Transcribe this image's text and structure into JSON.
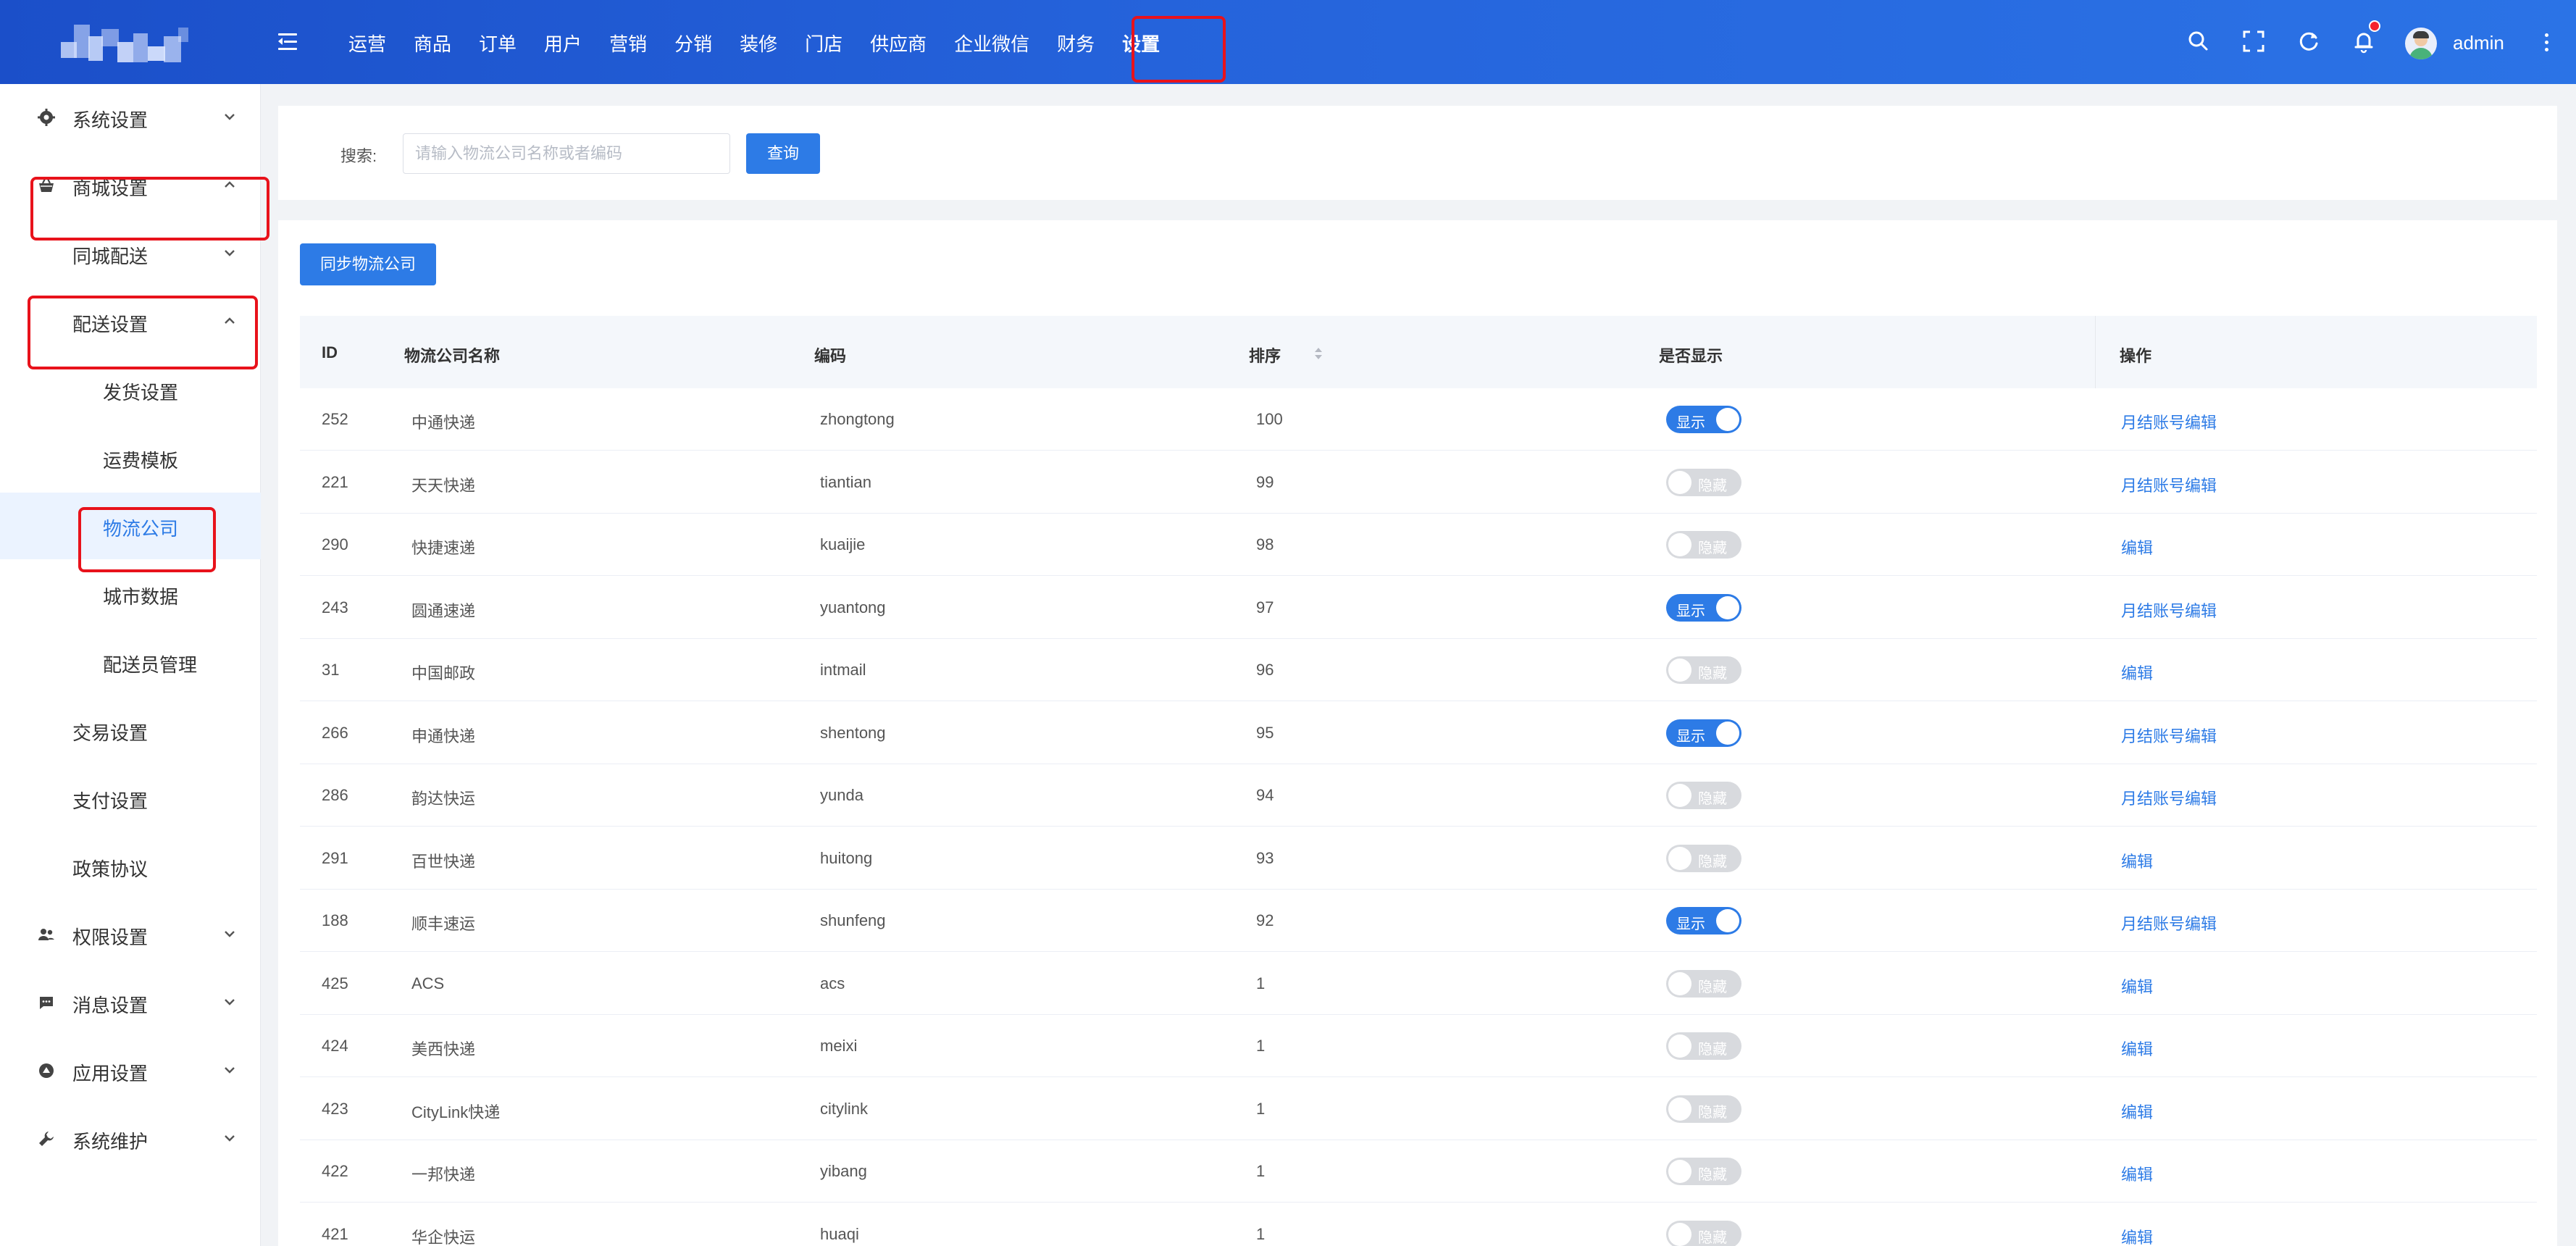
{
  "topnav": {
    "items": [
      {
        "label": "运营"
      },
      {
        "label": "商品"
      },
      {
        "label": "订单"
      },
      {
        "label": "用户"
      },
      {
        "label": "营销"
      },
      {
        "label": "分销"
      },
      {
        "label": "装修"
      },
      {
        "label": "门店"
      },
      {
        "label": "供应商"
      },
      {
        "label": "企业微信"
      },
      {
        "label": "财务"
      },
      {
        "label": "设置",
        "active": true
      }
    ],
    "icons": [
      "menu-collapse-icon",
      "search-icon",
      "fullscreen-icon",
      "refresh-icon",
      "bell-icon",
      "more-vertical-icon"
    ],
    "user_name": "admin",
    "notification_dot_color": "#f5222d"
  },
  "sidebar": {
    "items": [
      {
        "label": "系统设置",
        "icon": "gear-icon",
        "expanded": false
      },
      {
        "label": "商城设置",
        "icon": "basket-icon",
        "expanded": true
      },
      {
        "label": "同城配送",
        "expanded": false
      },
      {
        "label": "配送设置",
        "expanded": true
      },
      {
        "label": "发货设置"
      },
      {
        "label": "运费模板"
      },
      {
        "label": "物流公司",
        "active": true
      },
      {
        "label": "城市数据"
      },
      {
        "label": "配送员管理"
      },
      {
        "label": "交易设置"
      },
      {
        "label": "支付设置"
      },
      {
        "label": "政策协议"
      },
      {
        "label": "权限设置",
        "icon": "users-icon",
        "expanded": false
      },
      {
        "label": "消息设置",
        "icon": "message-icon",
        "expanded": false
      },
      {
        "label": "应用设置",
        "icon": "app-icon",
        "expanded": false
      },
      {
        "label": "系统维护",
        "icon": "wrench-icon",
        "expanded": false
      }
    ]
  },
  "search": {
    "label": "搜索:",
    "placeholder": "请输入物流公司名称或者编码",
    "value": "",
    "button": "查询"
  },
  "toolbar": {
    "sync_button": "同步物流公司"
  },
  "table": {
    "columns": [
      "ID",
      "物流公司名称",
      "编码",
      "排序",
      "是否显示",
      "操作"
    ],
    "switch_on_label": "显示",
    "switch_off_label": "隐藏",
    "rows": [
      {
        "id": "252",
        "name": "中通快递",
        "code": "zhongtong",
        "sort": "100",
        "visible": true,
        "action": "月结账号编辑"
      },
      {
        "id": "221",
        "name": "天天快递",
        "code": "tiantian",
        "sort": "99",
        "visible": false,
        "action": "月结账号编辑"
      },
      {
        "id": "290",
        "name": "快捷速递",
        "code": "kuaijie",
        "sort": "98",
        "visible": false,
        "action": "编辑"
      },
      {
        "id": "243",
        "name": "圆通速递",
        "code": "yuantong",
        "sort": "97",
        "visible": true,
        "action": "月结账号编辑"
      },
      {
        "id": "31",
        "name": "中国邮政",
        "code": "intmail",
        "sort": "96",
        "visible": false,
        "action": "编辑"
      },
      {
        "id": "266",
        "name": "申通快递",
        "code": "shentong",
        "sort": "95",
        "visible": true,
        "action": "月结账号编辑"
      },
      {
        "id": "286",
        "name": "韵达快运",
        "code": "yunda",
        "sort": "94",
        "visible": false,
        "action": "月结账号编辑"
      },
      {
        "id": "291",
        "name": "百世快递",
        "code": "huitong",
        "sort": "93",
        "visible": false,
        "action": "编辑"
      },
      {
        "id": "188",
        "name": "顺丰速运",
        "code": "shunfeng",
        "sort": "92",
        "visible": true,
        "action": "月结账号编辑"
      },
      {
        "id": "425",
        "name": "ACS",
        "code": "acs",
        "sort": "1",
        "visible": false,
        "action": "编辑"
      },
      {
        "id": "424",
        "name": "美西快递",
        "code": "meixi",
        "sort": "1",
        "visible": false,
        "action": "编辑"
      },
      {
        "id": "423",
        "name": "CityLink快递",
        "code": "citylink",
        "sort": "1",
        "visible": false,
        "action": "编辑"
      },
      {
        "id": "422",
        "name": "一邦快递",
        "code": "yibang",
        "sort": "1",
        "visible": false,
        "action": "编辑"
      },
      {
        "id": "421",
        "name": "华企快运",
        "code": "huaqi",
        "sort": "1",
        "visible": false,
        "action": "编辑"
      }
    ]
  },
  "colors": {
    "primary": "#2d7be6",
    "highlight_box": "#e8121b",
    "switch_off": "#d8dade"
  }
}
